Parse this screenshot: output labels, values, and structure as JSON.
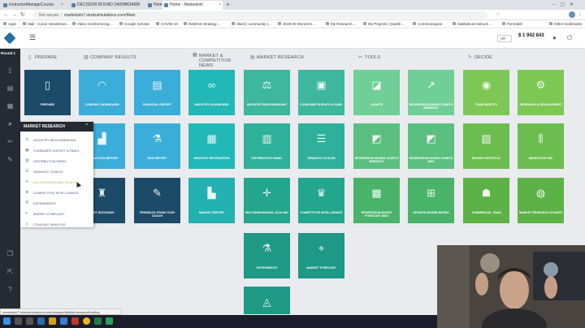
{
  "browser": {
    "tabs": [
      {
        "label": "InstructorManageCourse"
      },
      {
        "label": "DECISION ROUND DASHBOARD"
      },
      {
        "label": "Home - Marketsim"
      },
      {
        "label": "Home - Marketsim"
      }
    ],
    "new_tab": "+",
    "url_prefix": "Not secure",
    "url": "marketsim7.stratxsimulations.com/Main",
    "bookmarks": [
      "Apps",
      "Mail - Conor Henderson…",
      "Video Conferencing…",
      "Google Scholar",
      "COVID-19",
      "INSEAD Strategy…",
      "Slack | community |…",
      "2019-20 Women's…",
      "My Research…",
      "My Projects | Qualtri…",
      "Commonspace",
      "Sabbatical Instructi…",
      "Fernsdell",
      "Other bookmarks"
    ]
  },
  "app": {
    "round_label": "Round 1",
    "header_values": [
      "HR",
      "$ 1 942 843"
    ]
  },
  "sections": [
    "PREPARE",
    "COMPANY RESULTS",
    "MARKET & COMPETITIVE NEWS",
    "MARKET RESEARCH",
    "TOOLS",
    "DECIDE"
  ],
  "tiles": [
    {
      "label": "PREPARE",
      "icon": "book-icon",
      "glyph": "▯",
      "color": "#1c4a69"
    },
    {
      "label": "COMPANY DASHBOARD",
      "icon": "gauge-icon",
      "glyph": "◠",
      "color": "#3aaed8"
    },
    {
      "label": "FINANCIAL REPORT",
      "icon": "report-icon",
      "glyph": "▤",
      "color": "#3aaed8"
    },
    {
      "label": "INDUSTRY DASHBOARD",
      "icon": "glasses-icon",
      "glyph": "∞",
      "color": "#22b8b8"
    },
    {
      "label": "INDUSTRY BENCHMARKING",
      "icon": "scales-icon",
      "glyph": "⚖",
      "color": "#3db79d"
    },
    {
      "label": "CONSUMER SURVEY & PANEL",
      "icon": "survey-icon",
      "glyph": "▣",
      "color": "#3db79d"
    },
    {
      "label": "CHARTS",
      "icon": "chart-icon",
      "glyph": "◪",
      "color": "#6fcf97"
    },
    {
      "label": "REGRESSION-BASED CHARTS SEMANTIC",
      "icon": "chart-up-icon",
      "glyph": "↗",
      "color": "#6fcf97"
    },
    {
      "label": "TEAM IDENTITY",
      "icon": "team-icon",
      "glyph": "◉",
      "color": "#7dc855"
    },
    {
      "label": "RESEARCH & DEVELOPMENT",
      "icon": "rnd-icon",
      "glyph": "⚙",
      "color": "#7dc855"
    },
    {
      "label": "PRODUCTION REPORT",
      "icon": "factory-icon",
      "glyph": "▟",
      "color": "#3aaed8"
    },
    {
      "label": "R&D REPORT",
      "icon": "flask-icon",
      "glyph": "⚗",
      "color": "#3aaed8"
    },
    {
      "label": "INDUSTRY INFORMATION",
      "icon": "news-icon",
      "glyph": "▦",
      "color": "#22b8b8"
    },
    {
      "label": "DISTRIBUTION PANEL",
      "icon": "store-icon",
      "glyph": "▥",
      "color": "#2fb09b"
    },
    {
      "label": "SEMANTIC SCALES",
      "icon": "scale-icon",
      "glyph": "☰",
      "color": "#2fb09b"
    },
    {
      "label": "REGRESSION-BASED CHARTS SEMANTIC",
      "icon": "chart-line-icon",
      "glyph": "◩",
      "color": "#5bbf7f"
    },
    {
      "label": "REGRESSION-BASED CHARTS MDS",
      "icon": "chart-line-icon",
      "glyph": "◩",
      "color": "#5bbf7f"
    },
    {
      "label": "BRAND PORTFOLIO",
      "icon": "brand-icon",
      "glyph": "▨",
      "color": "#6bbd50"
    },
    {
      "label": "MARKETING MIX",
      "icon": "sliders-icon",
      "glyph": "⫼",
      "color": "#6bbd50"
    },
    {
      "label": "PAST DECISIONS",
      "icon": "chess-icon",
      "glyph": "♜",
      "color": "#1c4a69"
    },
    {
      "label": "FEEDBACK FROM YOUR COACH",
      "icon": "feedback-icon",
      "glyph": "✎",
      "color": "#1c4a69"
    },
    {
      "label": "MARKET REPORT",
      "icon": "market-icon",
      "glyph": "▙",
      "color": "#22b0b0"
    },
    {
      "label": "MULTIDIMENSIONAL SCALING",
      "icon": "mds-icon",
      "glyph": "✛",
      "color": "#24a58e"
    },
    {
      "label": "COMPETITIVE INTELLIGENCE",
      "icon": "trophy-icon",
      "glyph": "♛",
      "color": "#24a58e"
    },
    {
      "label": "REGRESSION-BASED FORECAST MDS",
      "icon": "forecast-icon",
      "glyph": "▩",
      "color": "#49b36a"
    },
    {
      "label": "GROWTH-SHARE MATRIX",
      "icon": "matrix-icon",
      "glyph": "⊞",
      "color": "#49b36a"
    },
    {
      "label": "COMMERCIAL TEAM",
      "icon": "people-icon",
      "glyph": "☗",
      "color": "#5db247"
    },
    {
      "label": "MARKET RESEARCH STUDIES",
      "icon": "globe-icon",
      "glyph": "◍",
      "color": "#5db247"
    },
    {
      "label": "EXPERIMENTS",
      "icon": "experiment-icon",
      "glyph": "⚗",
      "color": "#1d9985"
    },
    {
      "label": "MARKET FORECAST",
      "icon": "telescope-icon",
      "glyph": "⌖",
      "color": "#1d9985"
    },
    {
      "label": "",
      "icon": "chart-area-icon",
      "glyph": "◬",
      "color": "#1d9985"
    }
  ],
  "dropdown": {
    "title": "MARKET RESEARCH",
    "chevron": "⌃",
    "items": [
      "INDUSTRY BENCHMARKING",
      "CONSUMER SURVEY & PANEL",
      "DISTRIBUTION PANEL",
      "SEMANTIC SCALES",
      "MULTIDIMENSIONAL SCALING",
      "COMPETITIVE INTELLIGENCE",
      "EXPERIMENTS",
      "MARKET FORECAST",
      "CONJOINT ANALYSIS"
    ]
  },
  "status_url": "marketsim7.stratxsimulations.com/Analyze/MultidimensionalScaling"
}
